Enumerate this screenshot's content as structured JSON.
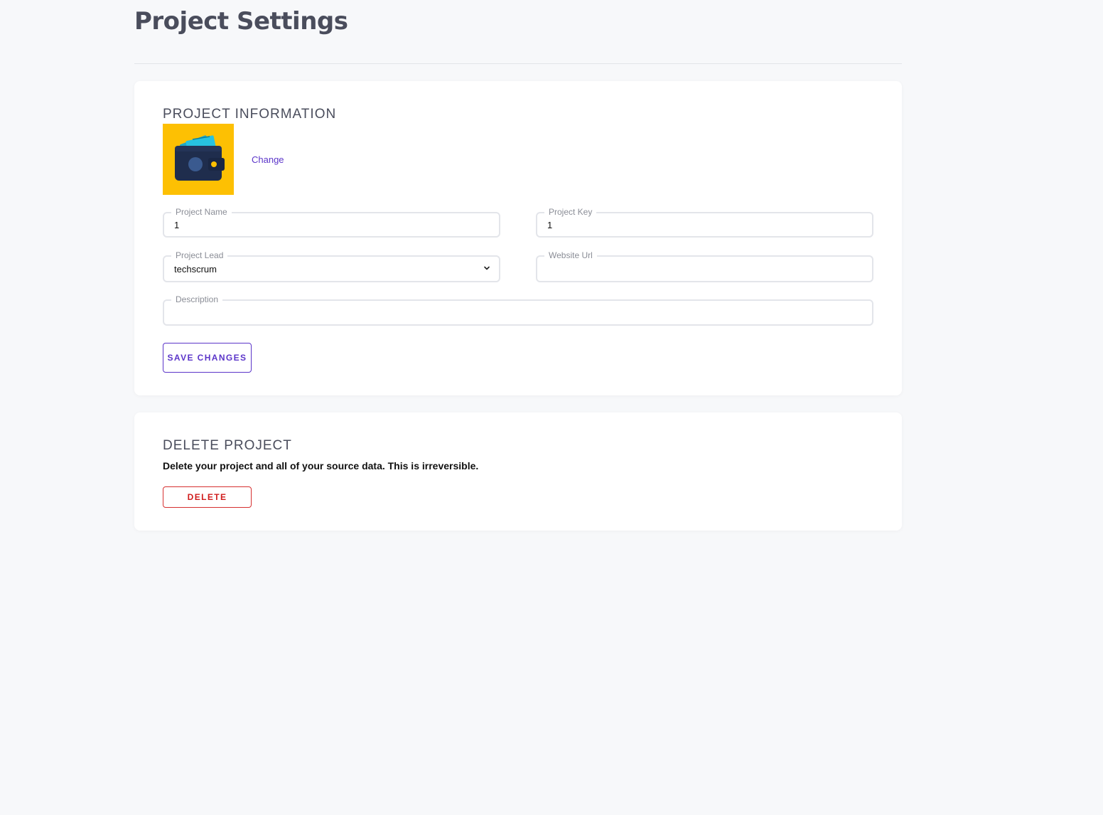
{
  "page": {
    "title": "Project Settings"
  },
  "project_info": {
    "heading": "PROJECT INFORMATION",
    "icon": "wallet-icon",
    "change_label": "Change",
    "fields": {
      "project_name": {
        "label": "Project Name",
        "value": "1"
      },
      "project_key": {
        "label": "Project Key",
        "value": "1"
      },
      "project_lead": {
        "label": "Project Lead",
        "value": "techscrum"
      },
      "website_url": {
        "label": "Website Url",
        "value": ""
      },
      "description": {
        "label": "Description",
        "value": ""
      }
    },
    "save_label": "SAVE CHANGES"
  },
  "delete_project": {
    "heading": "DELETE PROJECT",
    "description": "Delete your project and all of your source data. This is irreversible.",
    "delete_label": "DELETE"
  },
  "colors": {
    "background": "#f7f8fa",
    "accent": "#5b35c9",
    "danger": "#d01c1c",
    "icon_background": "#fdc003"
  }
}
